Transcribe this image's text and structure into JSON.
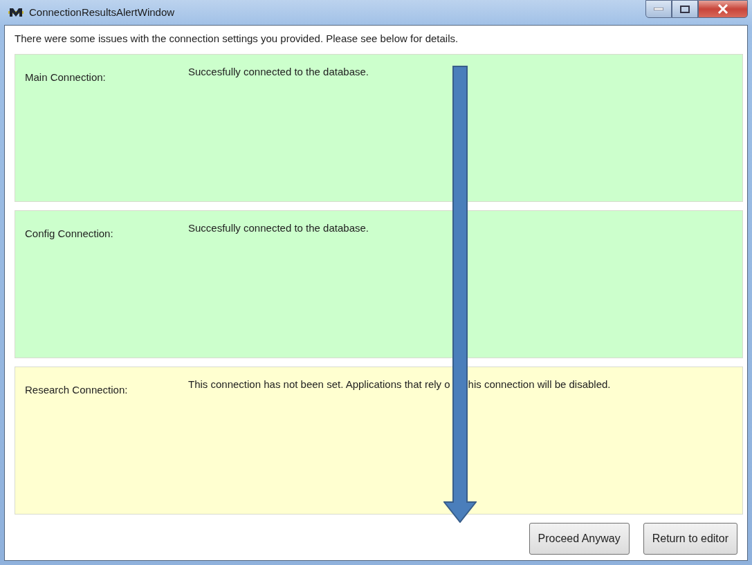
{
  "window": {
    "title": "ConnectionResultsAlertWindow"
  },
  "intro": "There were some issues with the connection settings you provided. Please see below for details.",
  "connections": [
    {
      "label": "Main Connection:",
      "message": [
        "Succesfully connected to the database."
      ],
      "color": "#ccffcc"
    },
    {
      "label": "Config Connection:",
      "message": [
        "Succesfully connected to the database."
      ],
      "color": "#ccffcc"
    },
    {
      "label": "Research Connection:",
      "message": [
        "This connection has not been set. Applications that rely o",
        "his connection will be disabled."
      ],
      "color": "#ffffd0"
    }
  ],
  "buttons": [
    "Proceed Anyway",
    "Return to editor"
  ]
}
